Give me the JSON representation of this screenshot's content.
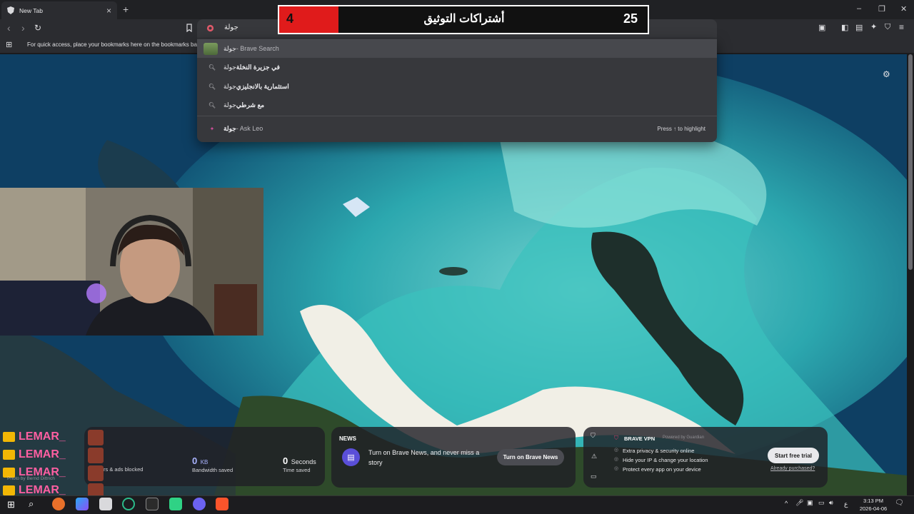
{
  "tab": {
    "title": "New Tab",
    "close": "×",
    "new_tab": "+"
  },
  "window": {
    "minimize": "–",
    "restore": "❐",
    "close": "✕"
  },
  "address_bar": {
    "value": "جولة"
  },
  "bookmarks_bar": {
    "hint": "For quick access, place your bookmarks here on the bookmarks bar."
  },
  "dropdown": {
    "items": [
      {
        "query": "جولة",
        "suffix": " - Brave Search"
      },
      {
        "query": "جولة ",
        "bold": "في جزيرة النخلة"
      },
      {
        "query": "جولة ",
        "bold": "استثمارية بالانجليزي"
      },
      {
        "query": "جولة ",
        "bold": "مع شرطي"
      },
      {
        "query": "جولة",
        "suffix": " - Ask Leo"
      }
    ],
    "hint": "Press ↑ to highlight"
  },
  "banner": {
    "left_number": "4",
    "title": "أشتراكات التوثيق",
    "right_number": "25"
  },
  "stats": {
    "ads_label": "rs & ads blocked",
    "bandwidth_value": "0",
    "bandwidth_unit": "KB",
    "bandwidth_label": "Bandwidth saved",
    "time_value": "0",
    "time_unit": "Seconds",
    "time_label": "Time saved"
  },
  "news": {
    "heading": "NEWS",
    "text": "Turn on Brave News, and never miss a story",
    "button": "Turn on Brave News"
  },
  "vpn": {
    "title": "BRAVE VPN",
    "powered": "Powered by Guardian",
    "features": [
      "Extra privacy & security online",
      "Hide your IP & change your location",
      "Protect every app on your device"
    ],
    "button": "Start free trial",
    "link": "Already purchased?"
  },
  "chat": {
    "names": [
      "LEMAR_",
      "LEMAR_",
      "LEMAR_",
      "LEMAR_"
    ],
    "photo_credit": "Photo by Bernd Dittrich"
  },
  "taskbar": {
    "time": "3:13 PM",
    "date": "2026-04-06",
    "lang": "ع"
  },
  "colors": {
    "banner_red": "#e01b1b",
    "brave_orange": "#fb542b",
    "chat_pink": "#ff5fa2",
    "crown": "#f2b705"
  }
}
